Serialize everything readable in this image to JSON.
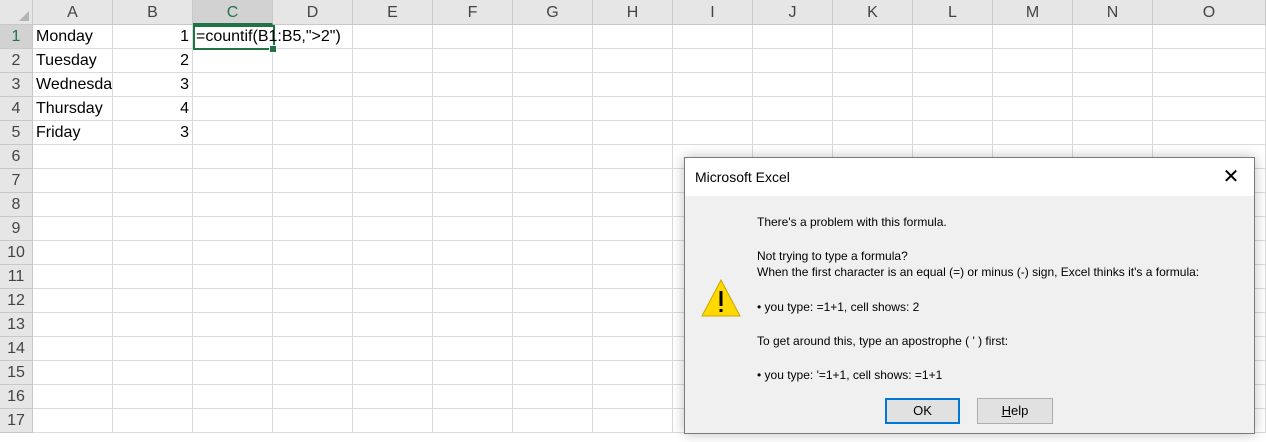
{
  "columns": [
    "A",
    "B",
    "C",
    "D",
    "E",
    "F",
    "G",
    "H",
    "I",
    "J",
    "K",
    "L",
    "M",
    "N",
    "O"
  ],
  "active_column": "C",
  "rows": [
    "1",
    "2",
    "3",
    "4",
    "5",
    "6",
    "7",
    "8",
    "9",
    "10",
    "11",
    "12",
    "13",
    "14",
    "15",
    "16",
    "17"
  ],
  "active_row": "1",
  "cells": {
    "A1": "Monday",
    "A2": "Tuesday",
    "A3": "Wednesda",
    "A4": "Thursday",
    "A5": "Friday",
    "B1": "1",
    "B2": "2",
    "B3": "3",
    "B4": "4",
    "B5": "3",
    "C1": "=countif(B1:B5,\">2\")"
  },
  "dialog": {
    "title": "Microsoft Excel",
    "close_glyph": "✕",
    "icon": "warning-icon",
    "message": {
      "line1": "There's a problem with this formula.",
      "line2": "Not trying to type a formula?",
      "line3": "When the first character is an equal (=) or minus (-) sign, Excel thinks it's a formula:",
      "line4": "• you type:   =1+1, cell shows:   2",
      "line5": "To get around this, type an apostrophe ( ' ) first:",
      "line6": "• you type:   '=1+1, cell shows:   =1+1"
    },
    "ok_label": "OK",
    "help_label_u": "H",
    "help_label_rest": "elp"
  },
  "colors": {
    "accent": "#217346",
    "dialog_focus": "#0078d7",
    "warning": "#ffd800"
  }
}
